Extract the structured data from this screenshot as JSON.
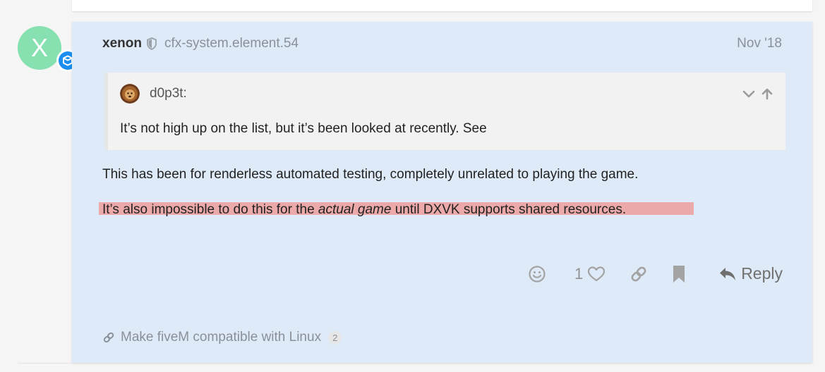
{
  "post": {
    "avatar_letter": "X",
    "username": "xenon",
    "user_title": "cfx-system.element.54",
    "date": "Nov '18",
    "quote": {
      "username": "d0p3t:",
      "text": "It’s not high up on the list, but it’s been looked at recently. See"
    },
    "paragraph1": "This has been for renderless automated testing, completely unrelated to playing the game.",
    "paragraph2": {
      "before": "It’s also impossible to do this for the ",
      "emphasis": "actual game",
      "after": " until DXVK supports shared resources."
    },
    "actions": {
      "like_count": "1",
      "reply_label": "Reply"
    },
    "linked_topic": {
      "title": "Make fiveM compatible with Linux",
      "count": "2"
    }
  },
  "colors": {
    "post_background": "#deeaf8",
    "avatar_bg": "#86e0b0",
    "badge_blue": "#1a8ef0",
    "highlight": "#eca9a9"
  },
  "icons": [
    "shield-icon",
    "cube-badge-icon",
    "chevron-down-icon",
    "arrow-up-icon",
    "smile-icon",
    "heart-icon",
    "link-icon",
    "bookmark-icon",
    "reply-icon"
  ]
}
